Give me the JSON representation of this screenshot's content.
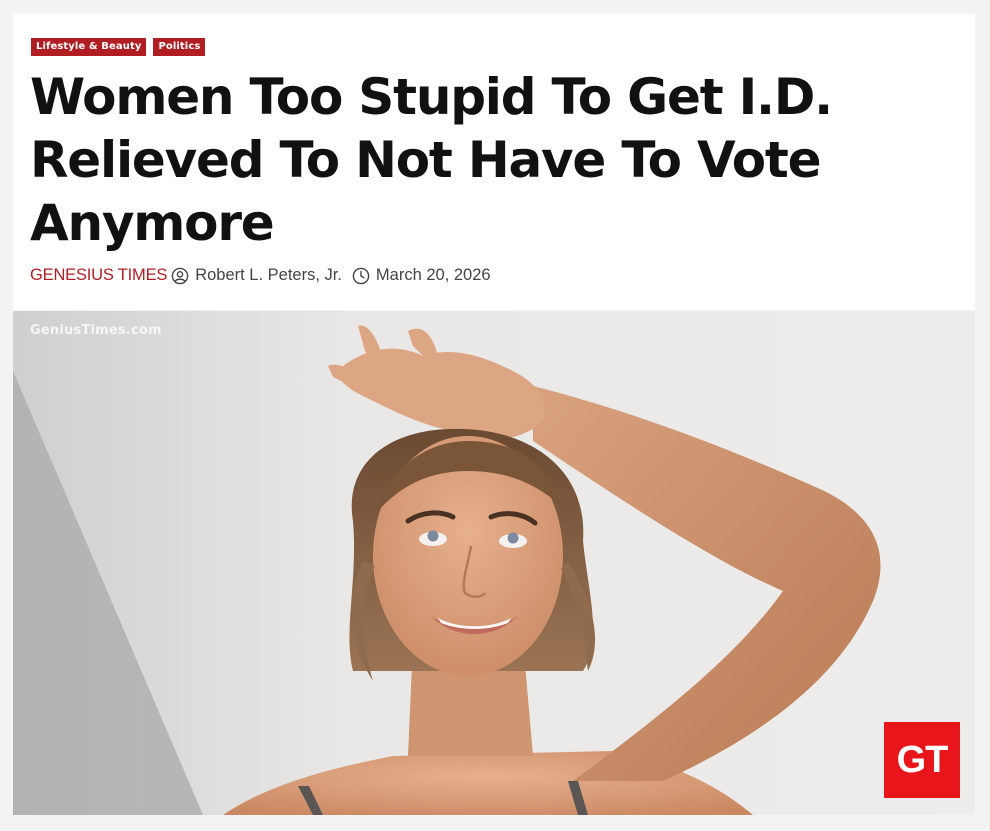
{
  "categories": [
    "Lifestyle & Beauty",
    "Politics"
  ],
  "headline": "Women Too Stupid To Get I.D. Relieved To Not Have To Vote Anymore",
  "meta": {
    "source": "GENESIUS TIMES",
    "author": "Robert L. Peters, Jr.",
    "date": "March 20, 2026"
  },
  "image": {
    "watermark": "GeniusTimes.com",
    "logo_text": "GT"
  },
  "icons": {
    "author": "user-circle-icon",
    "date": "clock-icon"
  },
  "colors": {
    "accent": "#b01e23",
    "logo": "#e8151b"
  }
}
